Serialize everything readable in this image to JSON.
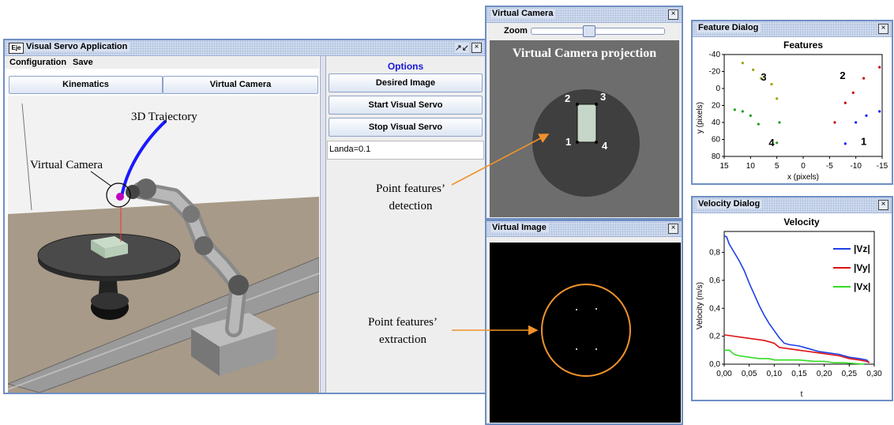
{
  "main_window": {
    "title": "Visual Servo Application",
    "app_icon": "Eje",
    "menu": [
      "Configuration",
      "Save"
    ],
    "tabs": [
      "Kinematics",
      "Virtual Camera"
    ],
    "options": {
      "title": "Options",
      "buttons": [
        "Desired Image",
        "Start Visual Servo",
        "Stop Visual Servo"
      ],
      "status": "Landa=0.1"
    },
    "scene_labels": {
      "trajectory": "3D Trajectory",
      "camera": "Virtual Camera"
    }
  },
  "virtual_camera": {
    "title": "Virtual Camera",
    "zoom_label": "Zoom",
    "zoom_level": 0.42,
    "projection_title": "Virtual Camera projection",
    "corner_labels": [
      "1",
      "2",
      "3",
      "4"
    ]
  },
  "virtual_image": {
    "title": "Virtual Image"
  },
  "annotations": {
    "detection": [
      "Point features’",
      "detection"
    ],
    "extraction": [
      "Point features’",
      "extraction"
    ]
  },
  "feature_dialog": {
    "title": "Feature Dialog",
    "chart_data": {
      "type": "scatter",
      "title": "Features",
      "xlabel": "x (pixels)",
      "ylabel": "y (pixels)",
      "xlim": [
        15,
        -15
      ],
      "ylim": [
        -40,
        80
      ],
      "x_ticks": [
        15,
        10,
        5,
        0,
        -5,
        -10,
        -15
      ],
      "y_ticks": [
        -40,
        -20,
        0,
        20,
        40,
        60,
        80
      ],
      "group_labels": [
        {
          "text": "2",
          "x": -7.5,
          "y": -15
        },
        {
          "text": "3",
          "x": 7.5,
          "y": -13
        },
        {
          "text": "4",
          "x": 6,
          "y": 64
        },
        {
          "text": "1",
          "x": -11.5,
          "y": 63
        }
      ],
      "series": [
        {
          "color": "#1a1aff",
          "points": [
            [
              -8,
              65
            ],
            [
              -10,
              40
            ],
            [
              -12,
              32
            ],
            [
              -14.5,
              27
            ]
          ]
        },
        {
          "color": "#cc0000",
          "points": [
            [
              -6,
              40
            ],
            [
              -8,
              17
            ],
            [
              -9.5,
              5
            ],
            [
              -11.5,
              -12
            ],
            [
              -14.5,
              -25
            ]
          ]
        },
        {
          "color": "#1aa01a",
          "points": [
            [
              13,
              25
            ],
            [
              11.5,
              27
            ],
            [
              10,
              32
            ],
            [
              8.5,
              42
            ],
            [
              5,
              64
            ],
            [
              4.5,
              40
            ]
          ]
        },
        {
          "color": "#a0a000",
          "points": [
            [
              11.5,
              -30
            ],
            [
              9.5,
              -22
            ],
            [
              8,
              -12
            ],
            [
              6,
              -5
            ],
            [
              5,
              12
            ]
          ]
        }
      ]
    }
  },
  "velocity_dialog": {
    "title": "Velocity Dialog",
    "chart_data": {
      "type": "line",
      "title": "Velocity",
      "xlabel": "t",
      "ylabel": "Velocity (m/s)",
      "xlim": [
        0,
        0.3
      ],
      "ylim": [
        0,
        0.95
      ],
      "x_ticks": [
        "0,00",
        "0,05",
        "0,10",
        "0,15",
        "0,20",
        "0,25",
        "0,30"
      ],
      "x_tick_values": [
        0,
        0.05,
        0.1,
        0.15,
        0.2,
        0.25,
        0.3
      ],
      "y_ticks": [
        "0,0",
        "0,2",
        "0,4",
        "0,6",
        "0,8"
      ],
      "y_tick_values": [
        0,
        0.2,
        0.4,
        0.6,
        0.8
      ],
      "series": [
        {
          "name": "|Vz|",
          "color": "#1f3fe6",
          "x": [
            0,
            0.005,
            0.01,
            0.02,
            0.03,
            0.04,
            0.05,
            0.06,
            0.07,
            0.08,
            0.09,
            0.1,
            0.11,
            0.12,
            0.13,
            0.15,
            0.17,
            0.19,
            0.21,
            0.23,
            0.25,
            0.27,
            0.285,
            0.29
          ],
          "y": [
            0.92,
            0.91,
            0.86,
            0.8,
            0.74,
            0.67,
            0.58,
            0.5,
            0.42,
            0.35,
            0.29,
            0.24,
            0.19,
            0.15,
            0.14,
            0.13,
            0.11,
            0.09,
            0.08,
            0.07,
            0.05,
            0.04,
            0.03,
            0.01
          ]
        },
        {
          "name": "|Vy|",
          "color": "#dd1111",
          "x": [
            0,
            0.02,
            0.04,
            0.06,
            0.08,
            0.09,
            0.1,
            0.11,
            0.13,
            0.15,
            0.17,
            0.19,
            0.21,
            0.23,
            0.25,
            0.27,
            0.285,
            0.29
          ],
          "y": [
            0.21,
            0.2,
            0.19,
            0.18,
            0.17,
            0.16,
            0.15,
            0.12,
            0.11,
            0.1,
            0.09,
            0.08,
            0.07,
            0.06,
            0.04,
            0.03,
            0.02,
            0.01
          ]
        },
        {
          "name": "|Vx|",
          "color": "#33dd22",
          "x": [
            0,
            0.01,
            0.02,
            0.03,
            0.05,
            0.07,
            0.09,
            0.1,
            0.12,
            0.15,
            0.18,
            0.2,
            0.22,
            0.24,
            0.26,
            0.28
          ],
          "y": [
            0.1,
            0.1,
            0.07,
            0.06,
            0.05,
            0.04,
            0.04,
            0.03,
            0.03,
            0.03,
            0.02,
            0.02,
            0.01,
            0.01,
            0.005,
            0.0
          ]
        }
      ]
    }
  }
}
